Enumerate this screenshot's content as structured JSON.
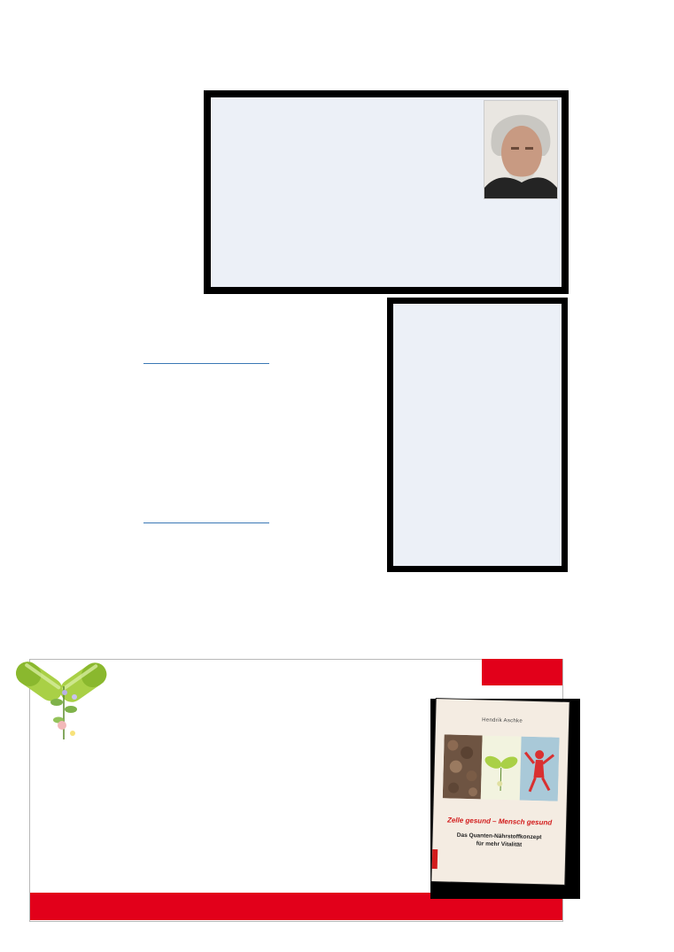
{
  "author_box": {
    "photo": {
      "alt": "Portrait of Hendrik Aschke"
    }
  },
  "ad": {
    "book": {
      "author": "Hendrik Aschke",
      "title": "Zelle gesund – Mensch gesund",
      "subtitle_line1": "Das Quanten-Nährstoffkonzept",
      "subtitle_line2": "für mehr Vitalität"
    }
  },
  "colors": {
    "brand_red": "#e2001a",
    "box_fill": "#ecf0f7",
    "link_blue": "#3a78b5",
    "capsule_green": "#9fc93c"
  },
  "icons": {
    "logo": "capsule-herb-logo-icon"
  }
}
